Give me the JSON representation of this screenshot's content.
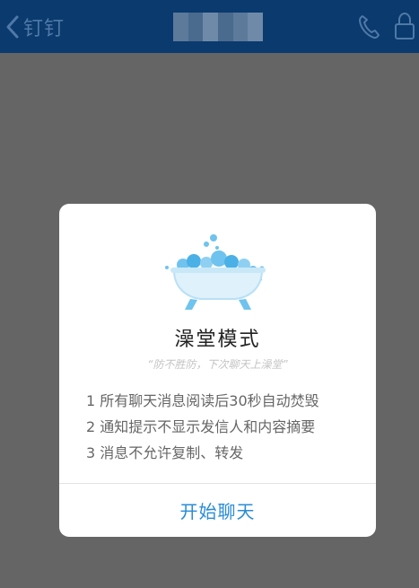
{
  "navbar": {
    "back_label": "钉钉",
    "icons": {
      "back": "chevron-left-icon",
      "call": "phone-icon",
      "lock": "lock-icon"
    },
    "title_obscured": true
  },
  "dialog": {
    "illustration": "bathtub-icon",
    "title": "澡堂模式",
    "subtitle": "“防不胜防，下次聊天上澡堂”",
    "rules": [
      "1 所有聊天消息阅读后30秒自动焚毁",
      "2 通知提示不显示发信人和内容摘要",
      "3 消息不允许复制、转发"
    ],
    "start_button": "开始聊天"
  },
  "colors": {
    "navbar_bg": "#0a3a6e",
    "overlay_bg": "#656565",
    "accent": "#2a8cd6",
    "bubble": "#6fc3ee"
  }
}
